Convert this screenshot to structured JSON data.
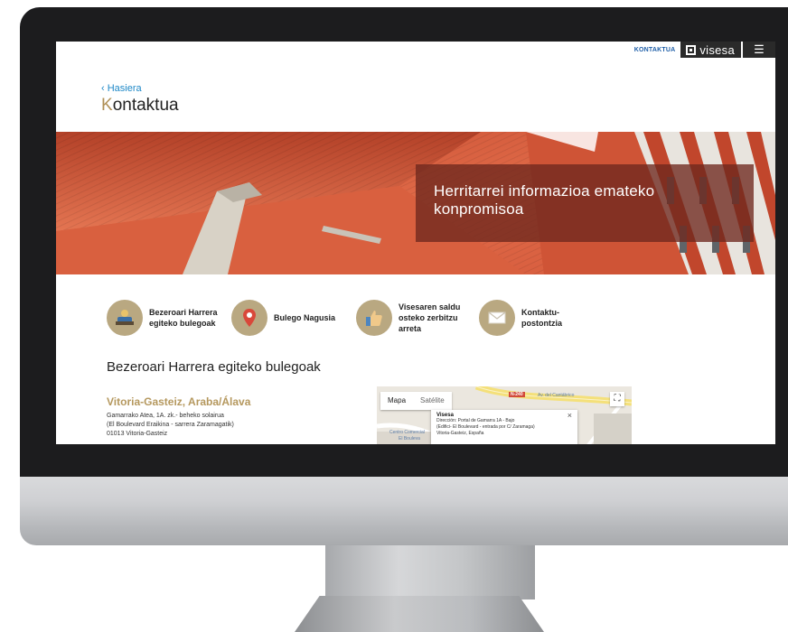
{
  "header": {
    "kontaktua_link": "KONTAKTUA",
    "logo_text": "visesa",
    "menu_icon": "hamburger-menu-icon"
  },
  "breadcrumb": "‹ Hasiera",
  "page_title": {
    "first_letter": "K",
    "rest": "ontaktua"
  },
  "hero": {
    "text": "Herritarrei informazioa emateko konpromisoa"
  },
  "contacts": [
    {
      "label": "Bezeroari Harrera egiteko bulegoak",
      "icon": "reception-desk-icon"
    },
    {
      "label": "Bulego Nagusia",
      "icon": "location-pin-icon"
    },
    {
      "label": "Visesaren saldu osteko zerbitzu arreta",
      "icon": "thumbs-up-icon"
    },
    {
      "label": "Kontaktu-postontzia",
      "icon": "envelope-icon"
    }
  ],
  "section_title": "Bezeroari Harrera egiteko bulegoak",
  "office": {
    "city": "Vitoria-Gasteiz, Araba/Álava",
    "lines": [
      "Gamarrako Atea, 1A. zk.- beheko solairua",
      "(El Boulevard Eraikina - sarrera Zaramagatik)",
      "01013 Vitoria-Gasteiz"
    ]
  },
  "map": {
    "tabs": [
      "Mapa",
      "Satélite"
    ],
    "popup": {
      "title": "Visesa",
      "lines": [
        "Dirección: Portal de Gamarra 1A - Bajo",
        "(Edifici- El Boulevard - entrada por C/ Zaramaga)",
        "Vitoria-Gasteiz, España"
      ]
    },
    "road_badge": "N-240",
    "street_label": "Av. del Cantábrico",
    "place_labels": [
      "Centro Comercial",
      "El Bouleva"
    ]
  },
  "colors": {
    "accent_gold": "#b09056",
    "link_blue": "#1e88c7",
    "hero_overlay": "#6e281e",
    "bezel": "#1c1c1e"
  }
}
